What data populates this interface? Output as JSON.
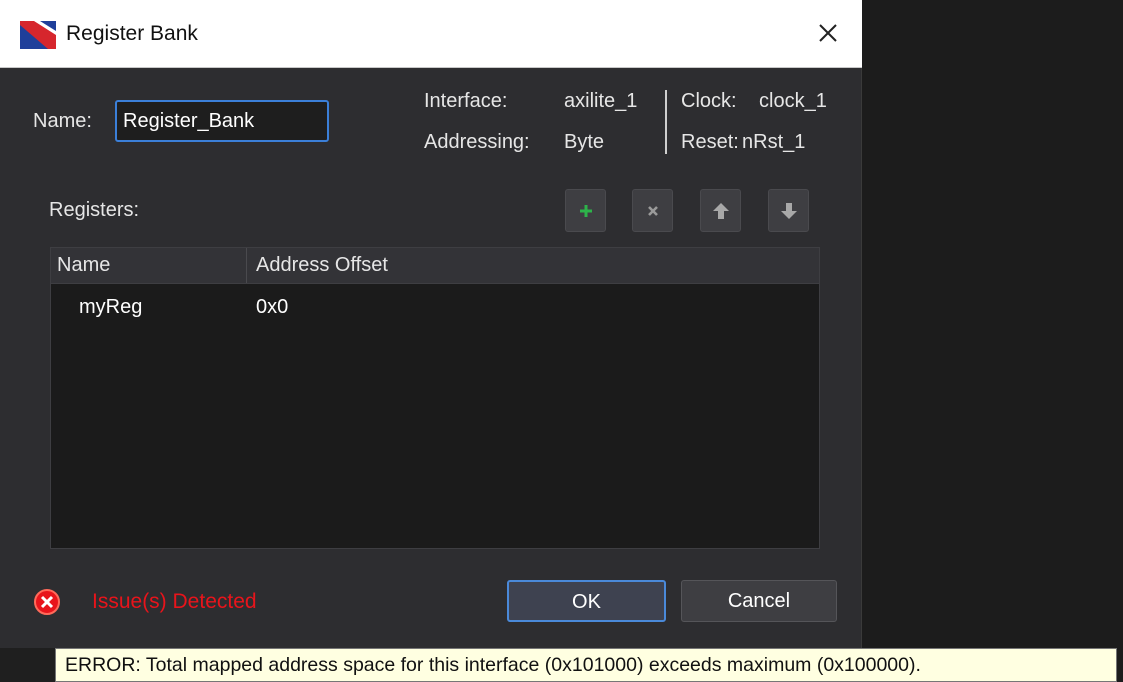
{
  "window": {
    "title": "Register Bank",
    "close_icon": "close-icon"
  },
  "form": {
    "name_label": "Name:",
    "name_value": "Register_Bank",
    "interface_label": "Interface:",
    "interface_value": "axilite_1",
    "addressing_label": "Addressing:",
    "addressing_value": "Byte",
    "clock_label": "Clock:",
    "clock_value": "clock_1",
    "reset_label": "Reset:",
    "reset_value": "nRst_1"
  },
  "registers": {
    "label": "Registers:",
    "toolbar": [
      {
        "icon": "plus-icon",
        "enabled": true
      },
      {
        "icon": "delete-icon",
        "enabled": false
      },
      {
        "icon": "arrow-up-icon",
        "enabled": false
      },
      {
        "icon": "arrow-down-icon",
        "enabled": false
      }
    ],
    "columns": [
      "Name",
      "Address Offset"
    ],
    "rows": [
      {
        "name": "myReg",
        "offset": "0x0"
      }
    ]
  },
  "status": {
    "text": "Issue(s) Detected",
    "icon": "error-icon",
    "color": "#e8141b"
  },
  "buttons": {
    "ok": "OK",
    "cancel": "Cancel"
  },
  "tooltip": {
    "text": "ERROR: Total mapped address space for this interface (0x101000) exceeds maximum (0x100000)."
  },
  "colors": {
    "accent": "#3b7fd8",
    "dialog_bg": "#2d2d30",
    "table_bg": "#1b1b1b",
    "tooltip_bg": "#ffffe1"
  }
}
